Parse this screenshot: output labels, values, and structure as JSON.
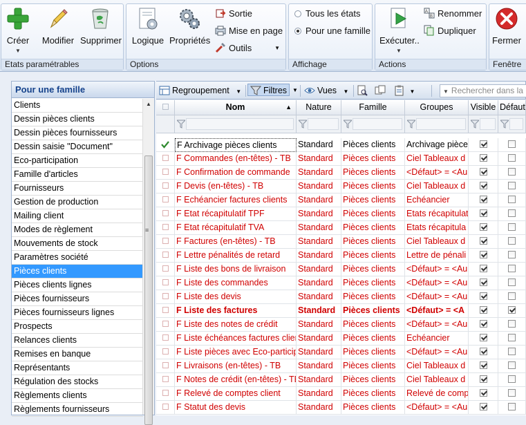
{
  "ribbon": {
    "groups": [
      {
        "label": "Etats paramétrables"
      },
      {
        "label": "Options"
      },
      {
        "label": "Affichage"
      },
      {
        "label": "Actions"
      },
      {
        "label": "Fenêtre"
      }
    ],
    "buttons": {
      "create": "Créer",
      "modify": "Modifier",
      "delete": "Supprimer",
      "logic": "Logique",
      "properties": "Propriétés",
      "output": "Sortie",
      "page_setup": "Mise en page",
      "tools": "Outils",
      "all_states": "Tous les états",
      "one_family": "Pour une famille",
      "execute": "Exécuter..",
      "rename": "Renommer",
      "duplicate": "Dupliquer",
      "close": "Fermer"
    },
    "view_mode_selected": "Pour une famille",
    "colors": {
      "accent_green": "#3aa53a",
      "close_red": "#d42b2b"
    }
  },
  "left_panel": {
    "title": "Pour une famille",
    "selected": "Pièces clients",
    "items": [
      "Clients",
      "Dessin pièces clients",
      "Dessin pièces fournisseurs",
      "Dessin saisie \"Document\"",
      "Eco-participation",
      "Famille d'articles",
      "Fournisseurs",
      "Gestion de production",
      "Mailing client",
      "Modes de règlement",
      "Mouvements de stock",
      "Paramètres société",
      "Pièces clients",
      "Pièces clients lignes",
      "Pièces fournisseurs",
      "Pièces fournisseurs lignes",
      "Prospects",
      "Relances clients",
      "Remises en banque",
      "Représentants",
      "Régulation des stocks",
      "Règlements clients",
      "Règlements fournisseurs"
    ]
  },
  "toolbar": {
    "grouping": "Regroupement",
    "filters": "Filtres",
    "views": "Vues",
    "search_placeholder": "Rechercher dans la"
  },
  "grid": {
    "columns": {
      "name": "Nom",
      "nature": "Nature",
      "family": "Famille",
      "groups": "Groupes",
      "visible": "Visible",
      "default": "Défaut"
    },
    "rows": [
      {
        "name": "F Archivage pièces clients",
        "nature": "Standard",
        "family": "Pièces clients",
        "groups": "Archivage pièces",
        "visible": true,
        "default": false,
        "style": "first"
      },
      {
        "name": "F Commandes (en-têtes) - TB",
        "nature": "Standard",
        "family": "Pièces clients",
        "groups": "Ciel Tableaux d",
        "visible": true,
        "default": false,
        "style": "red"
      },
      {
        "name": "F Confirmation de commande",
        "nature": "Standard",
        "family": "Pièces clients",
        "groups": "<Défaut> = <Au",
        "visible": true,
        "default": false,
        "style": "red"
      },
      {
        "name": "F Devis (en-têtes) - TB",
        "nature": "Standard",
        "family": "Pièces clients",
        "groups": "Ciel Tableaux d",
        "visible": true,
        "default": false,
        "style": "red"
      },
      {
        "name": "F Echéancier factures clients",
        "nature": "Standard",
        "family": "Pièces clients",
        "groups": "Echéancier",
        "visible": true,
        "default": false,
        "style": "red"
      },
      {
        "name": "F Etat récapitulatif TPF",
        "nature": "Standard",
        "family": "Pièces clients",
        "groups": "Etats récapitulat",
        "visible": true,
        "default": false,
        "style": "red"
      },
      {
        "name": "F Etat récapitulatif TVA",
        "nature": "Standard",
        "family": "Pièces clients",
        "groups": "Etats récapitula",
        "visible": true,
        "default": false,
        "style": "red"
      },
      {
        "name": "F Factures (en-têtes) - TB",
        "nature": "Standard",
        "family": "Pièces clients",
        "groups": "Ciel Tableaux d",
        "visible": true,
        "default": false,
        "style": "red"
      },
      {
        "name": "F Lettre pénalités de retard",
        "nature": "Standard",
        "family": "Pièces clients",
        "groups": "Lettre de pénali",
        "visible": true,
        "default": false,
        "style": "red"
      },
      {
        "name": "F Liste des bons de livraison",
        "nature": "Standard",
        "family": "Pièces clients",
        "groups": "<Défaut> = <Au",
        "visible": true,
        "default": false,
        "style": "red"
      },
      {
        "name": "F Liste des commandes",
        "nature": "Standard",
        "family": "Pièces clients",
        "groups": "<Défaut> = <Au",
        "visible": true,
        "default": false,
        "style": "red"
      },
      {
        "name": "F Liste des devis",
        "nature": "Standard",
        "family": "Pièces clients",
        "groups": "<Défaut> = <Au",
        "visible": true,
        "default": false,
        "style": "red"
      },
      {
        "name": "F Liste des factures",
        "nature": "Standard",
        "family": "Pièces clients",
        "groups": "<Défaut> = <A",
        "visible": true,
        "default": true,
        "style": "bold"
      },
      {
        "name": "F Liste des notes de crédit",
        "nature": "Standard",
        "family": "Pièces clients",
        "groups": "<Défaut> = <Au",
        "visible": true,
        "default": false,
        "style": "red"
      },
      {
        "name": "F Liste échéances factures client",
        "nature": "Standard",
        "family": "Pièces clients",
        "groups": "Echéancier",
        "visible": true,
        "default": false,
        "style": "red"
      },
      {
        "name": "F Liste pièces avec Eco-particip",
        "nature": "Standard",
        "family": "Pièces clients",
        "groups": "<Défaut> = <Au",
        "visible": true,
        "default": false,
        "style": "red"
      },
      {
        "name": "F Livraisons (en-têtes) - TB",
        "nature": "Standard",
        "family": "Pièces clients",
        "groups": "Ciel Tableaux d",
        "visible": true,
        "default": false,
        "style": "red"
      },
      {
        "name": "F Notes de crédit (en-têtes) - TB",
        "nature": "Standard",
        "family": "Pièces clients",
        "groups": "Ciel Tableaux d",
        "visible": true,
        "default": false,
        "style": "red"
      },
      {
        "name": "F Relevé de comptes client",
        "nature": "Standard",
        "family": "Pièces clients",
        "groups": "Relevé de comp",
        "visible": true,
        "default": false,
        "style": "red"
      },
      {
        "name": "F Statut des devis",
        "nature": "Standard",
        "family": "Pièces clients",
        "groups": "<Défaut> = <Au",
        "visible": true,
        "default": false,
        "style": "red"
      }
    ]
  }
}
